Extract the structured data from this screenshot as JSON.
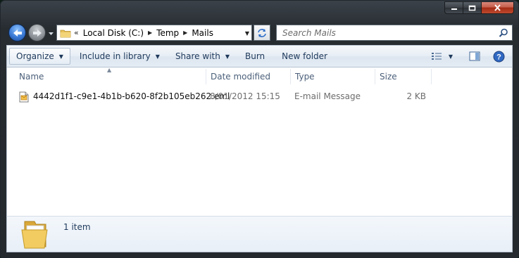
{
  "window": {
    "caption_buttons": {
      "minimize_icon": "minimize-icon",
      "maximize_icon": "maximize-icon",
      "close_icon": "close-icon"
    }
  },
  "nav": {
    "address": {
      "overflow": "«",
      "crumbs": [
        "Local Disk (C:)",
        "Temp",
        "Mails"
      ]
    },
    "search": {
      "placeholder": "Search Mails"
    }
  },
  "toolbar": {
    "organize": "Organize",
    "include_in_library": "Include in library",
    "share_with": "Share with",
    "burn": "Burn",
    "new_folder": "New folder"
  },
  "columns": {
    "name": "Name",
    "date_modified": "Date modified",
    "type": "Type",
    "size": "Size"
  },
  "files": [
    {
      "name": "4442d1f1-c9e1-4b1b-b620-8f2b105eb262.eml",
      "date_modified": "8/01/2012 15:15",
      "type": "E-mail Message",
      "size": "2 KB",
      "icon": "eml-file-icon"
    }
  ],
  "details": {
    "item_count": "1 item"
  },
  "colors": {
    "accent": "#3c7bd6",
    "close": "#c65f4c",
    "command_text": "#1e395b"
  }
}
